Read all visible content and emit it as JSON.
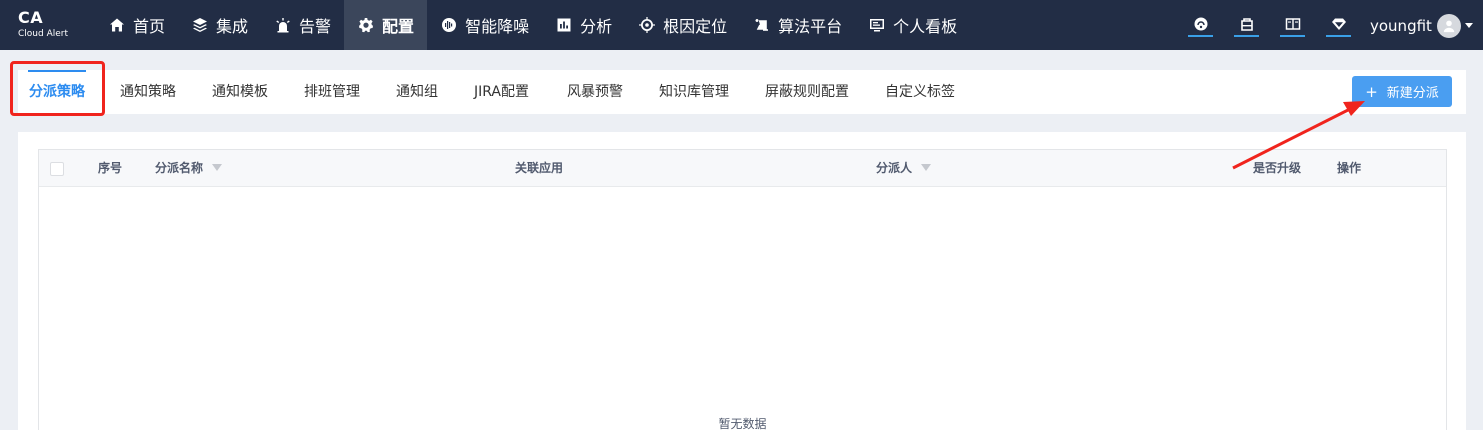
{
  "app": {
    "logo": "CA",
    "logo_sub": "Cloud Alert"
  },
  "nav": [
    {
      "label": "首页",
      "icon": "home-icon"
    },
    {
      "label": "集成",
      "icon": "layers-icon"
    },
    {
      "label": "告警",
      "icon": "alarm-icon"
    },
    {
      "label": "配置",
      "icon": "gear-icon",
      "active": true
    },
    {
      "label": "智能降噪",
      "icon": "noise-icon"
    },
    {
      "label": "分析",
      "icon": "bar-chart-icon"
    },
    {
      "label": "根因定位",
      "icon": "target-icon"
    },
    {
      "label": "算法平台",
      "icon": "algorithm-icon"
    },
    {
      "label": "个人看板",
      "icon": "dashboard-icon"
    }
  ],
  "tools": [
    "support-icon",
    "package-icon",
    "book-icon",
    "diamond-icon"
  ],
  "user": {
    "name": "youngfit"
  },
  "subtabs": [
    {
      "label": "分派策略",
      "active": true
    },
    {
      "label": "通知策略"
    },
    {
      "label": "通知模板"
    },
    {
      "label": "排班管理"
    },
    {
      "label": "通知组"
    },
    {
      "label": "JIRA配置"
    },
    {
      "label": "风暴预警"
    },
    {
      "label": "知识库管理"
    },
    {
      "label": "屏蔽规则配置"
    },
    {
      "label": "自定义标签"
    }
  ],
  "actions": {
    "new_label": "新建分派",
    "new_icon": "+"
  },
  "table": {
    "columns": {
      "index": "序号",
      "name": "分派名称",
      "apps": "关联应用",
      "assignee": "分派人",
      "escalate": "是否升级",
      "ops": "操作"
    },
    "empty_text": "暂无数据"
  },
  "colors": {
    "topbar": "#222d45",
    "accent": "#2d8cf0",
    "button": "#4a9ef1",
    "annotation": "#f0241d"
  }
}
